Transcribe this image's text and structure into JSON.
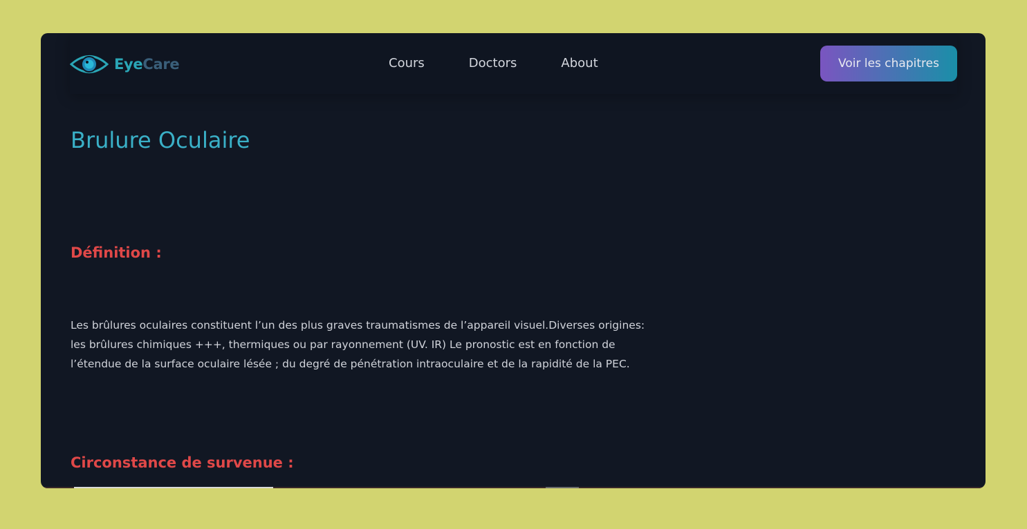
{
  "app": {
    "logo": {
      "part1": "Eye",
      "part2": "Care"
    }
  },
  "nav": {
    "links": [
      {
        "label": "Cours"
      },
      {
        "label": "Doctors"
      },
      {
        "label": "About"
      }
    ],
    "cta_label": "Voir les chapitres"
  },
  "main": {
    "title": "Brulure Oculaire",
    "sections": [
      {
        "heading": "Définition :",
        "body": "Les brûlures oculaires constituent l’un des plus graves traumatismes de l’appareil visuel.Diverses origines: les brûlures chimiques +++, thermiques ou par rayonnement (UV. IR) Le pronostic est en fonction de l’étendue de la surface oculaire lésée ; du degré de pénétration intraoculaire et de la rapidité de la PEC."
      },
      {
        "heading": "Circonstance de survenue :"
      }
    ]
  },
  "colors": {
    "background": "#d2d470",
    "window": "#111723",
    "accent_title": "#3ab0c7",
    "section_heading": "#e04848",
    "cta_gradient_start": "#7a55c0",
    "cta_gradient_end": "#1a8fa8"
  },
  "icons": {
    "logo": "eye-icon"
  }
}
